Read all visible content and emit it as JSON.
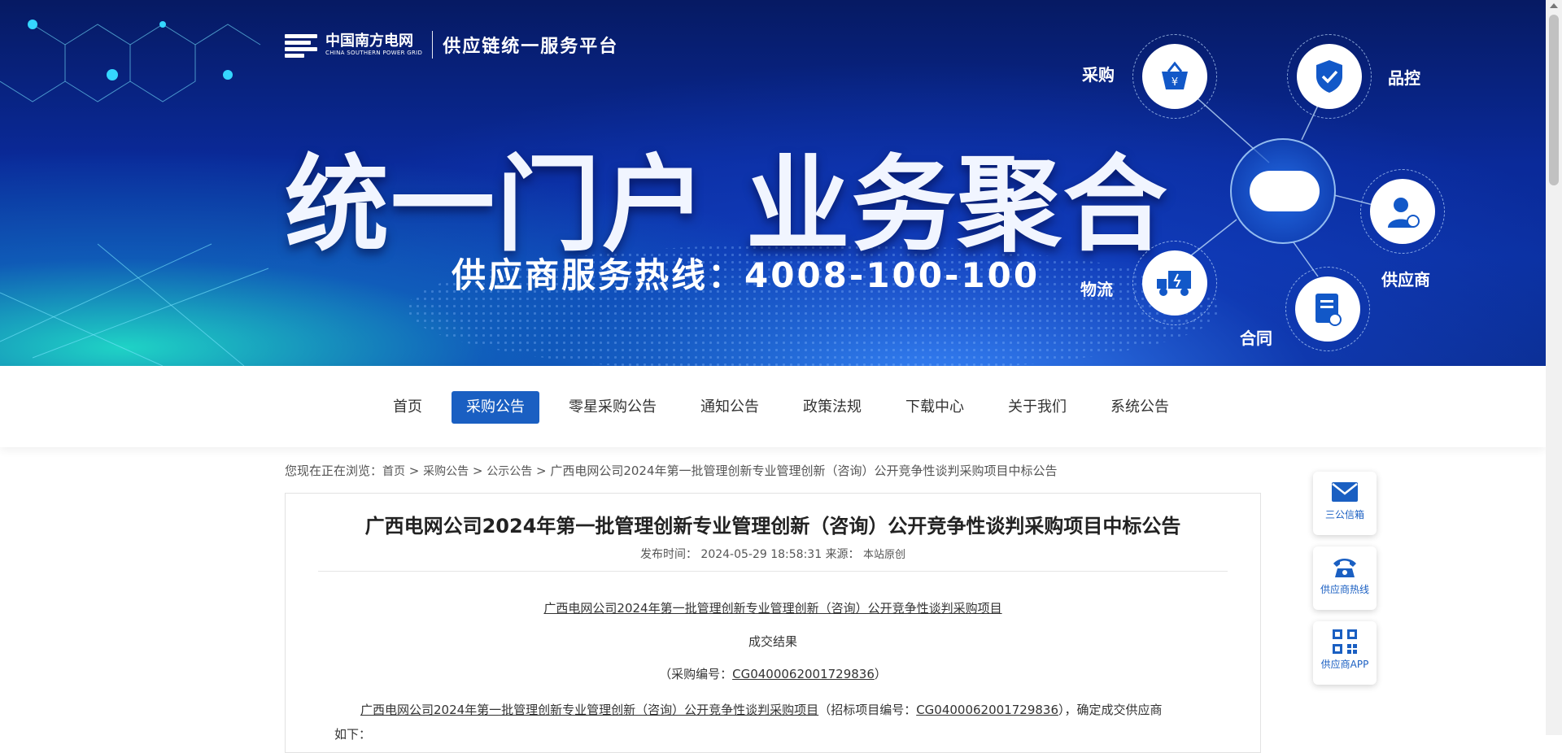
{
  "header": {
    "logo_name": "中国南方电网",
    "logo_en": "CHINA SOUTHERN POWER GRID",
    "platform": "供应链统一服务平台",
    "slogan": "统一门户  业务聚合",
    "hotline": "供应商服务热线：4008-100-100",
    "nodes": {
      "purchase": "采购",
      "quality": "品控",
      "supplier": "供应商",
      "contract": "合同",
      "logistics": "物流"
    }
  },
  "nav": {
    "items": [
      "首页",
      "采购公告",
      "零星采购公告",
      "通知公告",
      "政策法规",
      "下载中心",
      "关于我们",
      "系统公告"
    ],
    "active_index": 1
  },
  "breadcrumb": {
    "prefix": "您现在正在浏览：",
    "home": "首页",
    "sep": " > ",
    "level1": "采购公告",
    "level2": "公示公告",
    "current": "广西电网公司2024年第一批管理创新专业管理创新（咨询）公开竞争性谈判采购项目中标公告"
  },
  "article": {
    "title": "广西电网公司2024年第一批管理创新专业管理创新（咨询）公开竞争性谈判采购项目中标公告",
    "meta_time_label": "发布时间：",
    "meta_time": "2024-05-29 18:58:31",
    "meta_source_label": "来源：",
    "meta_source": "本站原创",
    "project_link": "广西电网公司2024年第一批管理创新专业管理创新（咨询）公开竞争性谈判采购项目",
    "result": "成交结果",
    "code_prefix": "（采购编号：",
    "code": "CG0400062001729836",
    "code_suffix": "）",
    "body_project": "广西电网公司2024年第一批管理创新专业管理创新（咨询）公开竞争性谈判采购项目",
    "body_mid": "（招标项目编号：",
    "body_code": "CG0400062001729836",
    "body_end": "），确定成交供应商",
    "body_line2": "如下："
  },
  "side": {
    "mailbox": "三公信箱",
    "hotline": "供应商热线",
    "app": "供应商APP"
  },
  "colors": {
    "accent": "#1a5fc2",
    "banner_dark": "#061a63"
  }
}
